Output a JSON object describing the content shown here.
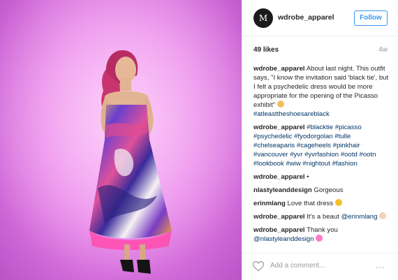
{
  "post": {
    "author": {
      "avatar_text": "M",
      "username": "wdrobe_apparel"
    },
    "follow_label": "Follow",
    "likes": "49 likes",
    "time": "4w",
    "caption": {
      "username": "wdrobe_apparel",
      "text": "About last night. This outfit says, \"I know the invitation said 'black tie', but I felt a psychedelic dress would be more appropriate for the opening of the Picasso exhibit\"",
      "emoji": "woman-tipping-hand-emoji",
      "tag": "#atleasttheshoesareblack"
    },
    "hashtags": {
      "username": "wdrobe_apparel",
      "tags": [
        "#blacktie",
        "#picasso",
        "#psychedelic",
        "#fyodorgolan",
        "#tulle",
        "#chelseaparis",
        "#cageheels",
        "#pinkhair",
        "#vancouver",
        "#yvr",
        "#yvrfashion",
        "#ootd",
        "#ootn",
        "#lookbook",
        "#wiw",
        "#nightout",
        "#fashion"
      ]
    },
    "comments": [
      {
        "username": "wdrobe_apparel",
        "text": "•"
      },
      {
        "username": "nlastyleanddesign",
        "text": "Gorgeous"
      },
      {
        "username": "erinmlang",
        "text": "Love that dress",
        "emoji": "heart-eyes-emoji"
      },
      {
        "username": "wdrobe_apparel",
        "text": "It's a beaut ",
        "mention": "@erinmlang",
        "emoji": "ok-hand-emoji"
      },
      {
        "username": "wdrobe_apparel",
        "text": "Thank you",
        "mention": "@nlastyleanddesign",
        "emoji": "sparkling-heart-emoji"
      }
    ],
    "add_comment_placeholder": "Add a comment...",
    "more_label": "...",
    "icons": {
      "like": "heart-outline-icon",
      "more": "ellipsis-icon"
    },
    "colors": {
      "link": "#003569",
      "follow": "#3897f0",
      "muted": "#999999",
      "backdrop": "#e989ea"
    }
  }
}
